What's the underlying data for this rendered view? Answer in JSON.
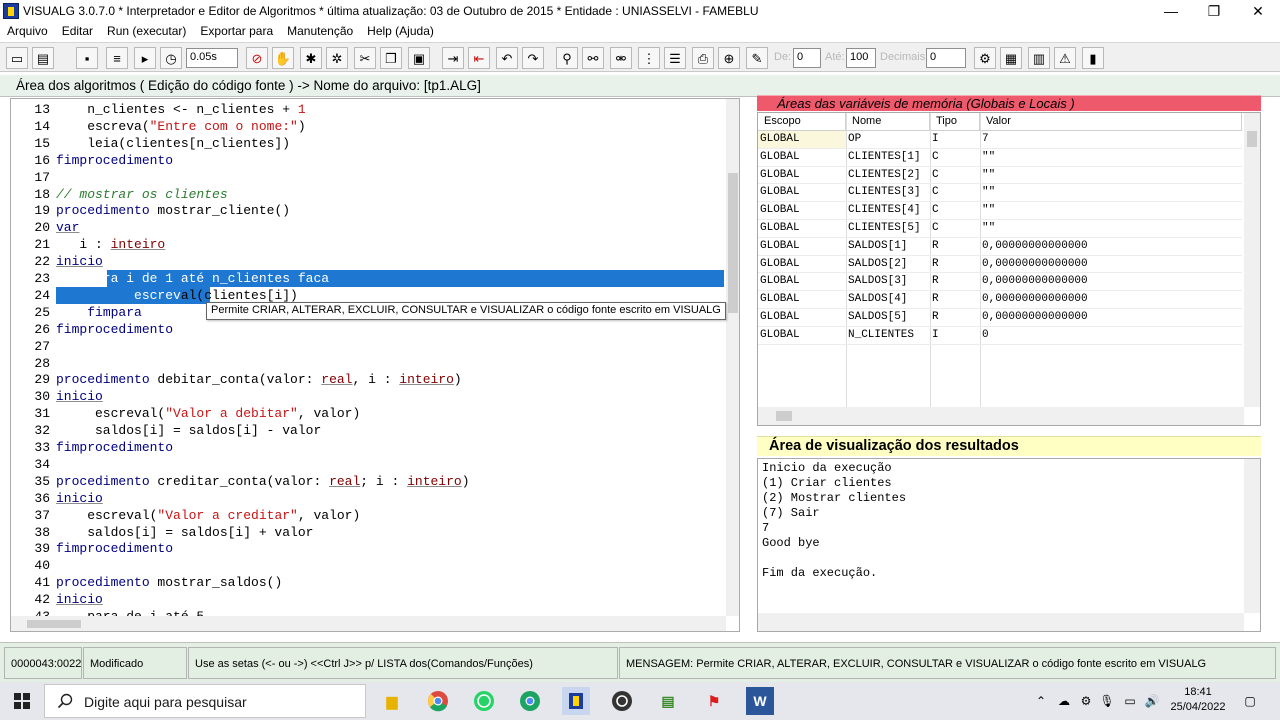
{
  "window": {
    "title": "VISUALG 3.0.7.0 * Interpretador e Editor de Algoritmos * última atualização: 03 de Outubro de 2015 * Entidade : UNIASSELVI - FAMEBLU",
    "minimize": "—",
    "maximize": "❐",
    "close": "✕"
  },
  "menu": [
    {
      "label": "Arquivo"
    },
    {
      "label": "Editar"
    },
    {
      "label": "Run (executar)"
    },
    {
      "label": "Exportar para"
    },
    {
      "label": "Manutenção"
    },
    {
      "label": "Help (Ajuda)"
    }
  ],
  "toolbar": {
    "speed_value": "0.05s",
    "de_label": "De:",
    "de_value": "0",
    "ate_label": "Até:",
    "ate_value": "100",
    "decimais_label": "Decimais:",
    "decimais_value": "0"
  },
  "editor": {
    "header": "Área dos algoritmos ( Edição do código fonte ) -> Nome do arquivo: [tp1.ALG]",
    "lines": [
      {
        "n": "13",
        "html": "    n_clientes <- n_clientes + <span class='num'>1</span>"
      },
      {
        "n": "14",
        "html": "    escreva(<span class='str'>\"Entre com o nome:\"</span>)"
      },
      {
        "n": "15",
        "html": "    leia(clientes[n_clientes])"
      },
      {
        "n": "16",
        "html": "<span class='kw'>fimprocedimento</span>"
      },
      {
        "n": "17",
        "html": ""
      },
      {
        "n": "18",
        "html": "<span class='cm'>// mostrar os clientes</span>"
      },
      {
        "n": "19",
        "html": "<span class='kw'>procedimento</span> mostrar_cliente()"
      },
      {
        "n": "20",
        "html": "<span class='hl'>var</span>"
      },
      {
        "n": "21",
        "html": "   i : <span class='tp'>inteiro</span>"
      },
      {
        "n": "22",
        "html": "<span class='hl'>inicio</span>"
      },
      {
        "n": "23",
        "html": "    para i de 1 até n_clientes faca"
      },
      {
        "n": "24",
        "html": "          escreval(clientes[i])"
      },
      {
        "n": "25",
        "html": "    <span class='kw'>fimpara</span>"
      },
      {
        "n": "26",
        "html": "<span class='kw'>fimprocedimento</span>"
      },
      {
        "n": "27",
        "html": ""
      },
      {
        "n": "28",
        "html": ""
      },
      {
        "n": "29",
        "html": "<span class='kw'>procedimento</span> debitar_conta(valor: <span class='tp'>real</span>, i : <span class='tp'>inteiro</span>)"
      },
      {
        "n": "30",
        "html": "<span class='hl'>inicio</span>"
      },
      {
        "n": "31",
        "html": "     escreval(<span class='str'>\"Valor a debitar\"</span>, valor)"
      },
      {
        "n": "32",
        "html": "     saldos[i] = saldos[i] - valor"
      },
      {
        "n": "33",
        "html": "<span class='kw'>fimprocedimento</span>"
      },
      {
        "n": "34",
        "html": ""
      },
      {
        "n": "35",
        "html": "<span class='kw'>procedimento</span> creditar_conta(valor: <span class='tp'>real</span>; i : <span class='tp'>inteiro</span>)"
      },
      {
        "n": "36",
        "html": "<span class='hl'>inicio</span>"
      },
      {
        "n": "37",
        "html": "    escreval(<span class='str'>\"Valor a creditar\"</span>, valor)"
      },
      {
        "n": "38",
        "html": "    saldos[i] = saldos[i] + valor"
      },
      {
        "n": "39",
        "html": "<span class='kw'>fimprocedimento</span>"
      },
      {
        "n": "40",
        "html": ""
      },
      {
        "n": "41",
        "html": "<span class='kw'>procedimento</span> mostrar_saldos()"
      },
      {
        "n": "42",
        "html": "<span class='hl'>inicio</span>"
      },
      {
        "n": "43",
        "html": "    para de i até 5"
      }
    ],
    "tooltip": "Permite CRIAR, ALTERAR, EXCLUIR, CONSULTAR e VISUALIZAR o código fonte escrito em VISUALG"
  },
  "variables": {
    "header": "Áreas das variáveis de memória (Globais e Locais )",
    "columns": [
      "Escopo",
      "Nome",
      "Tipo",
      "Valor"
    ],
    "rows": [
      {
        "escopo": "GLOBAL",
        "nome": "OP",
        "tipo": "I",
        "valor": "7"
      },
      {
        "escopo": "GLOBAL",
        "nome": "CLIENTES[1]",
        "tipo": "C",
        "valor": "\"\""
      },
      {
        "escopo": "GLOBAL",
        "nome": "CLIENTES[2]",
        "tipo": "C",
        "valor": "\"\""
      },
      {
        "escopo": "GLOBAL",
        "nome": "CLIENTES[3]",
        "tipo": "C",
        "valor": "\"\""
      },
      {
        "escopo": "GLOBAL",
        "nome": "CLIENTES[4]",
        "tipo": "C",
        "valor": "\"\""
      },
      {
        "escopo": "GLOBAL",
        "nome": "CLIENTES[5]",
        "tipo": "C",
        "valor": "\"\""
      },
      {
        "escopo": "GLOBAL",
        "nome": "SALDOS[1]",
        "tipo": "R",
        "valor": "0,00000000000000"
      },
      {
        "escopo": "GLOBAL",
        "nome": "SALDOS[2]",
        "tipo": "R",
        "valor": "0,00000000000000"
      },
      {
        "escopo": "GLOBAL",
        "nome": "SALDOS[3]",
        "tipo": "R",
        "valor": "0,00000000000000"
      },
      {
        "escopo": "GLOBAL",
        "nome": "SALDOS[4]",
        "tipo": "R",
        "valor": "0,00000000000000"
      },
      {
        "escopo": "GLOBAL",
        "nome": "SALDOS[5]",
        "tipo": "R",
        "valor": "0,00000000000000"
      },
      {
        "escopo": "GLOBAL",
        "nome": "N_CLIENTES",
        "tipo": "I",
        "valor": "0"
      }
    ]
  },
  "output": {
    "header": "Área de visualização dos resultados",
    "lines": [
      "Inicio da execução",
      "(1) Criar clientes",
      "(2) Mostrar clientes",
      "(7) Sair",
      "7",
      "Good bye",
      "",
      "Fim da execução."
    ]
  },
  "status": {
    "position": "0000043:0022",
    "state": "Modificado",
    "hint": "Use as setas (<- ou ->) <<Ctrl J>> p/ LISTA dos(Comandos/Funções)",
    "message": "MENSAGEM: Permite CRIAR, ALTERAR, EXCLUIR, CONSULTAR e VISUALIZAR o código fonte escrito em VISUALG"
  },
  "taskbar": {
    "search_placeholder": "Digite aqui para pesquisar",
    "time": "18:41",
    "date": "25/04/2022"
  },
  "colors": {
    "selection": "#1e78d2",
    "vars_header": "#ee5a6b",
    "output_header": "#ffffc4",
    "statusbar": "#e2efe2"
  }
}
